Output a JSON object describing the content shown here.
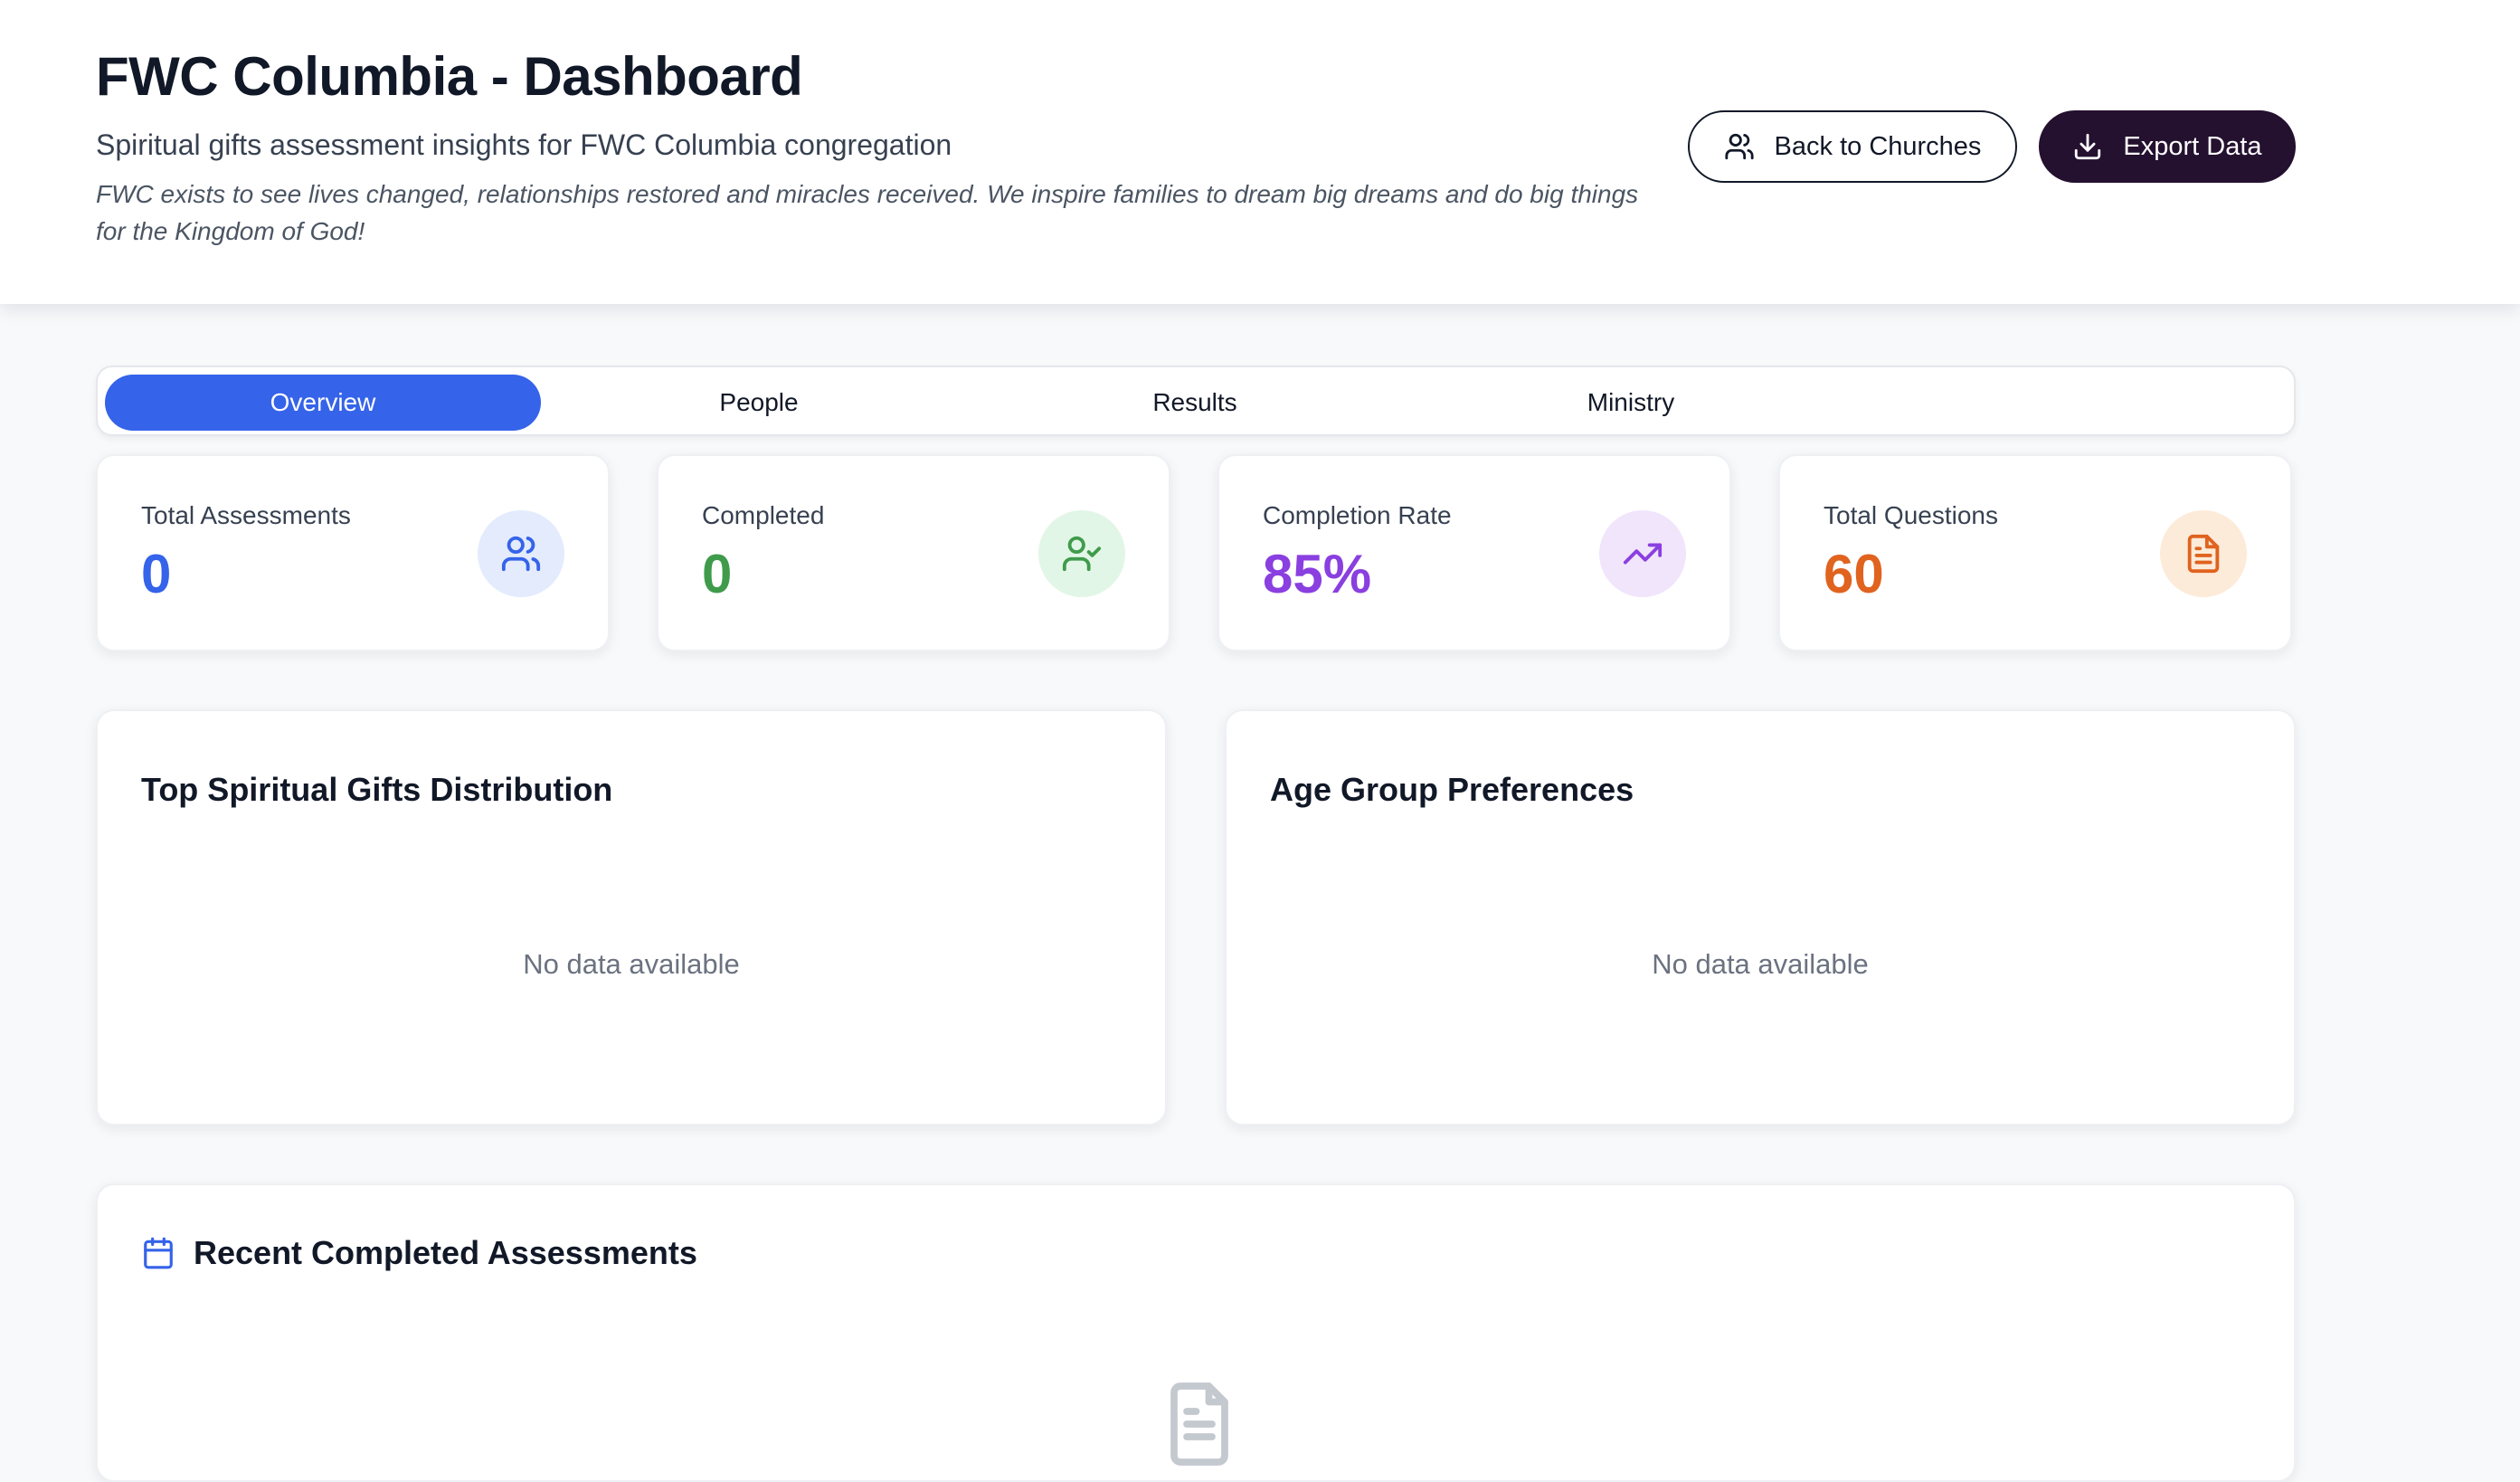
{
  "header": {
    "title": "FWC Columbia - Dashboard",
    "subtitle": "Spiritual gifts assessment insights for FWC Columbia congregation",
    "mission": "FWC exists to see lives changed, relationships restored and miracles received. We inspire families to dream big dreams and do big things for the Kingdom of God!",
    "back_label": "Back to Churches",
    "export_label": "Export Data"
  },
  "tabs": [
    {
      "label": "Overview",
      "active": true
    },
    {
      "label": "People",
      "active": false
    },
    {
      "label": "Results",
      "active": false
    },
    {
      "label": "Ministry",
      "active": false
    }
  ],
  "stats": [
    {
      "label": "Total Assessments",
      "value": "0",
      "color": "#3563e9",
      "icon": "users-icon"
    },
    {
      "label": "Completed",
      "value": "0",
      "color": "#3f9b4b",
      "icon": "user-check-icon"
    },
    {
      "label": "Completion Rate",
      "value": "85%",
      "color": "#8a3fe0",
      "icon": "trending-up-icon"
    },
    {
      "label": "Total Questions",
      "value": "60",
      "color": "#e0631f",
      "icon": "file-text-icon"
    }
  ],
  "panels": {
    "gifts": {
      "title": "Top Spiritual Gifts Distribution",
      "empty": "No data available"
    },
    "age": {
      "title": "Age Group Preferences",
      "empty": "No data available"
    }
  },
  "recent": {
    "title": "Recent Completed Assessments",
    "icon": "calendar-icon"
  },
  "colors": {
    "primary": "#3563e9",
    "dark_button": "#24102f"
  }
}
